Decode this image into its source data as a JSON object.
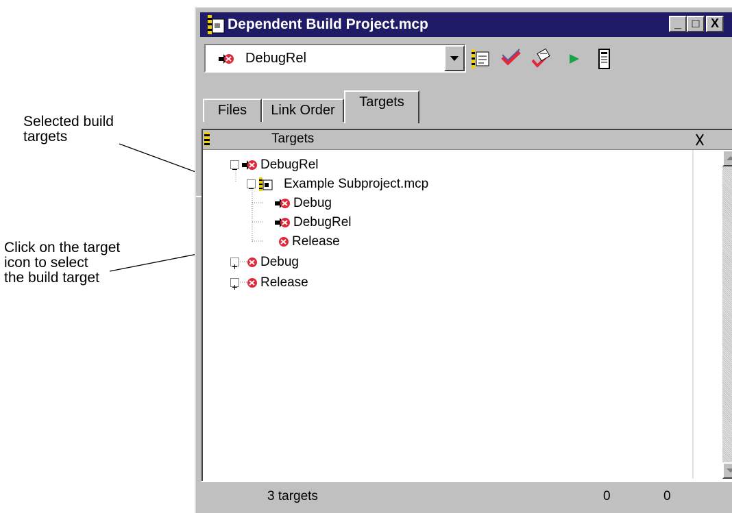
{
  "callouts": {
    "selected_targets": "Selected build\ntargets",
    "click_icon": "Click on the target\nicon to select\nthe build target"
  },
  "window": {
    "title": "Dependent Build Project.mcp",
    "buttons": {
      "minimize": "_",
      "maximize": "□",
      "close": "X"
    }
  },
  "toolbar": {
    "target_select": "DebugRel",
    "tools": [
      "target-settings-icon",
      "synchronize-check-icon",
      "make-icon",
      "run-icon",
      "debug-icon"
    ]
  },
  "tabs": [
    "Files",
    "Link Order",
    "Targets"
  ],
  "active_tab": "Targets",
  "list": {
    "header": "Targets",
    "rows": [
      {
        "label": "DebugRel",
        "level": 0,
        "expander": "−",
        "icon": "target-selected-icon"
      },
      {
        "label": "Example Subproject.mcp",
        "level": 1,
        "expander": "−",
        "icon": "project-file-icon"
      },
      {
        "label": "Debug",
        "level": 2,
        "expander": "",
        "icon": "target-selected-icon"
      },
      {
        "label": "DebugRel",
        "level": 2,
        "expander": "",
        "icon": "target-selected-icon"
      },
      {
        "label": "Release",
        "level": 2,
        "expander": "",
        "icon": "target-icon"
      },
      {
        "label": "Debug",
        "level": 0,
        "expander": "+",
        "icon": "target-icon"
      },
      {
        "label": "Release",
        "level": 0,
        "expander": "+",
        "icon": "target-icon"
      }
    ]
  },
  "status": {
    "count": "3 targets",
    "value_a": "0",
    "value_b": "0"
  },
  "colors": {
    "titlebar": "#1f1b66",
    "target_red": "#e0283a",
    "chrome": "#c0c0c0"
  }
}
